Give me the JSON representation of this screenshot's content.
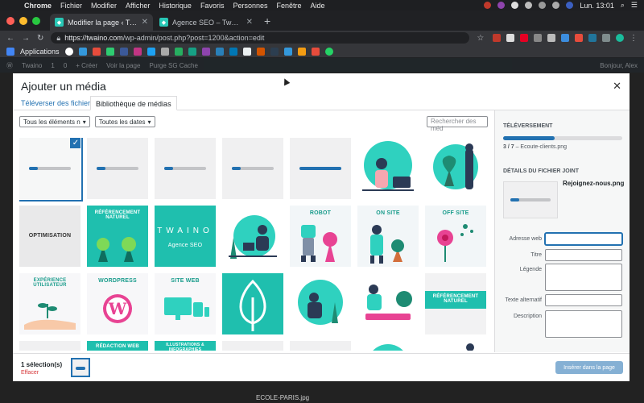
{
  "menubar": {
    "app": "Chrome",
    "items": [
      "Fichier",
      "Modifier",
      "Afficher",
      "Historique",
      "Favoris",
      "Personnes",
      "Fenêtre",
      "Aide"
    ],
    "clock": "Lun. 13:01"
  },
  "tabs": [
    {
      "title": "Modifier la page ‹ Twaino — W"
    },
    {
      "title": "Agence SEO – Twaino"
    }
  ],
  "address": {
    "host": "https://twaino.com",
    "path": "/wp-admin/post.php?post=1200&action=edit"
  },
  "bookmarks": {
    "apps_label": "Applications"
  },
  "wp_admin_bar": {
    "site": "Twaino",
    "updates": "1",
    "comments": "0",
    "new": "+ Créer",
    "view": "Voir la page",
    "purge": "Purge SG Cache",
    "greeting": "Bonjour, Alex"
  },
  "modal": {
    "title": "Ajouter un média",
    "tab_upload": "Téléverser des fichiers",
    "tab_library": "Bibliothèque de médias",
    "filter_type": "Tous les éléments n",
    "filter_date": "Toutes les dates",
    "search_placeholder": "Rechercher des méd"
  },
  "tiles": {
    "row2": [
      "OPTIMISATION",
      "RÉFÉRENCEMENT NATUREL",
      "TWAINO",
      "ROBOT",
      "ON SITE",
      "OFF SITE"
    ],
    "twaino_sub": "Agence SEO",
    "row3": [
      "EXPÉRIENCE UTILISATEUR",
      "WORDPRESS",
      "SITE WEB",
      "",
      "",
      "",
      "RÉFÉRENCEMENT NATUREL"
    ],
    "row4": [
      "RÉDACTION WEB",
      "ILLUSTRATIONS & INFOGRAPHIES"
    ]
  },
  "upload": {
    "heading": "TÉLÉVERSEMENT",
    "progress": 0.43,
    "count": "3 / 7",
    "filename": "Ecoute-clients.png"
  },
  "details": {
    "heading": "DÉTAILS DU FICHIER JOINT",
    "filename": "Rejoignez-nous.png",
    "label_url": "Adresse web",
    "label_title": "Titre",
    "label_caption": "Légende",
    "label_alt": "Texte alternatif",
    "label_desc": "Description"
  },
  "footer": {
    "selection": "1 sélection(s)",
    "clear": "Effacer",
    "insert": "Insérer dans la page"
  },
  "bottom_file": "ECOLE-PARIS.jpg",
  "colors": {
    "wp_blue": "#2271b1",
    "teal": "#28c8b6"
  }
}
